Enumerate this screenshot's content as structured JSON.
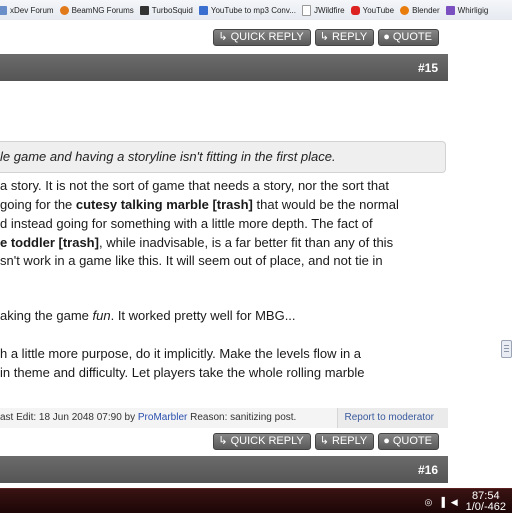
{
  "bookmarks": [
    {
      "label": "xDev Forum",
      "icon": "forum-icon",
      "color": "#6a8fc8"
    },
    {
      "label": "BeamNG Forums",
      "icon": "beamng-icon",
      "color": "#e07a1a"
    },
    {
      "label": "TurboSquid",
      "icon": "turbosquid-icon",
      "color": "#333333"
    },
    {
      "label": "YouTube to mp3 Conv...",
      "icon": "converter-icon",
      "color": "#3a6fd0"
    },
    {
      "label": "JWildfire",
      "icon": "page-icon",
      "color": "#ffffff"
    },
    {
      "label": "YouTube",
      "icon": "youtube-icon",
      "color": "#dd2222"
    },
    {
      "label": "Blender",
      "icon": "blender-icon",
      "color": "#e87d0d"
    },
    {
      "label": "Whirligig",
      "icon": "whirligig-icon",
      "color": "#7a4fc0"
    }
  ],
  "actions_top": {
    "quick_reply": "QUICK REPLY",
    "reply": "REPLY",
    "quote": "QUOTE"
  },
  "post15": {
    "number": "#15"
  },
  "quote_text": "le game and having a storyline isn't fitting in the first place.",
  "body": {
    "l1": "a story. It is not the sort of game that needs a story, nor the sort that",
    "l2a": " going for the ",
    "l2b": "cutesy talking marble [trash]",
    "l2c": " that would be the normal",
    "l3": "d instead going for something with a little more depth. The fact of",
    "l4a": "e toddler [trash]",
    "l4b": ", while inadvisable, is a far better fit than any of this",
    "l5": "sn't work in a game like this. It will seem out of place, and not tie in",
    "l6a": "aking the game ",
    "l6b": "fun",
    "l6c": ". It worked pretty well for MBG...",
    "l7": "h a little more purpose, do it implicitly. Make the levels flow in a",
    "l8": " in theme and difficulty. Let players take the whole rolling marble"
  },
  "edit_note": {
    "prefix": "ast Edit: 18 Jun 2048 07:90 by ",
    "user": "ProMarbler",
    "reason": " Reason: sanitizing post.",
    "report": "Report to moderator"
  },
  "actions_bottom": {
    "quick_reply": "QUICK REPLY",
    "reply": "REPLY",
    "quote": "QUOTE"
  },
  "post16": {
    "number": "#16"
  },
  "taskbar": {
    "time": "87:54",
    "date": "1/0/-462"
  }
}
